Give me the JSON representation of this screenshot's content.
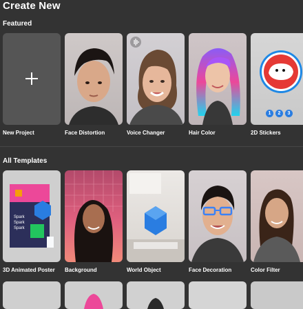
{
  "header": {
    "title": "Create New"
  },
  "featured": {
    "heading": "Featured",
    "items": [
      {
        "label": "New Project",
        "icon": "plus-icon"
      },
      {
        "label": "Face Distortion"
      },
      {
        "label": "Voice Changer",
        "icon": "audio-wave-icon"
      },
      {
        "label": "Hair Color"
      },
      {
        "label": "2D Stickers",
        "indicators": [
          "1",
          "2",
          "3"
        ]
      }
    ]
  },
  "templates": {
    "heading": "All Templates",
    "items": [
      {
        "label": "3D Animated Poster",
        "poster_text": [
          "Spark",
          "Spark",
          "Spark"
        ]
      },
      {
        "label": "Background"
      },
      {
        "label": "World Object"
      },
      {
        "label": "Face Decoration"
      },
      {
        "label": "Color Filter"
      }
    ]
  },
  "colors": {
    "background": "#333333",
    "card": "#555555",
    "accent": "#2a7de1"
  }
}
